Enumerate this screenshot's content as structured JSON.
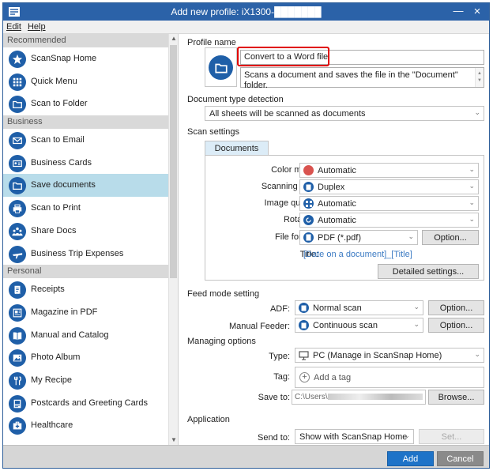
{
  "window": {
    "title": "Add new profile: iX1300-███████"
  },
  "menu": {
    "items": [
      "Edit",
      "Help"
    ]
  },
  "sidebar": {
    "sections": [
      {
        "header": "Recommended",
        "items": [
          {
            "label": "ScanSnap Home",
            "icon": "star-icon"
          },
          {
            "label": "Quick Menu",
            "icon": "grid-icon"
          },
          {
            "label": "Scan to Folder",
            "icon": "folder-icon"
          }
        ]
      },
      {
        "header": "Business",
        "items": [
          {
            "label": "Scan to Email",
            "icon": "email-icon"
          },
          {
            "label": "Business Cards",
            "icon": "id-card-icon"
          },
          {
            "label": "Save documents",
            "icon": "folder-icon",
            "selected": true
          },
          {
            "label": "Scan to Print",
            "icon": "printer-icon"
          },
          {
            "label": "Share Docs",
            "icon": "people-icon"
          },
          {
            "label": "Business Trip Expenses",
            "icon": "plane-icon"
          }
        ]
      },
      {
        "header": "Personal",
        "items": [
          {
            "label": "Receipts",
            "icon": "receipt-icon"
          },
          {
            "label": "Magazine in PDF",
            "icon": "magazine-icon"
          },
          {
            "label": "Manual and Catalog",
            "icon": "book-icon"
          },
          {
            "label": "Photo Album",
            "icon": "photo-icon"
          },
          {
            "label": "My Recipe",
            "icon": "utensils-icon"
          },
          {
            "label": "Postcards and Greeting Cards",
            "icon": "postcard-icon"
          },
          {
            "label": "Healthcare",
            "icon": "medical-icon"
          }
        ]
      }
    ]
  },
  "profile": {
    "heading": "Profile name",
    "name": "Convert to a Word file",
    "description": "Scans a document and saves the file in the \"Document\" folder."
  },
  "detection": {
    "heading": "Document type detection",
    "value": "All sheets will be scanned as documents"
  },
  "scan_settings": {
    "heading": "Scan settings",
    "tab": "Documents",
    "color_mode": {
      "label": "Color mode:",
      "value": "Automatic"
    },
    "scanning_side": {
      "label": "Scanning side:",
      "value": "Duplex"
    },
    "image_quality": {
      "label": "Image quality:",
      "value": "Automatic"
    },
    "rotation": {
      "label": "Rotation:",
      "value": "Automatic"
    },
    "file_format": {
      "label": "File format:",
      "value": "PDF (*.pdf)",
      "option": "Option..."
    },
    "title": {
      "label": "Title:",
      "value": "[Date on a document]_[Title]"
    },
    "detailed": "Detailed settings..."
  },
  "feed": {
    "heading": "Feed mode setting",
    "adf": {
      "label": "ADF:",
      "value": "Normal scan",
      "option": "Option..."
    },
    "manual": {
      "label": "Manual Feeder:",
      "value": "Continuous scan",
      "option": "Option..."
    }
  },
  "managing": {
    "heading": "Managing options",
    "type": {
      "label": "Type:",
      "value": "PC (Manage in ScanSnap Home)"
    },
    "tag": {
      "label": "Tag:",
      "value": "Add a tag"
    },
    "save_to": {
      "label": "Save to:",
      "value": "C:\\Users\\",
      "browse": "Browse..."
    }
  },
  "application": {
    "heading": "Application",
    "send_to": {
      "label": "Send to:",
      "value": "Show with ScanSnap Home",
      "set": "Set..."
    }
  },
  "footer": {
    "add": "Add",
    "cancel": "Cancel"
  },
  "colors": {
    "titlebar": "#2b62a8",
    "accent": "#1f5fa8",
    "selected": "#b8dcea",
    "highlight": "#e00000",
    "add_button": "#1e73c8"
  }
}
